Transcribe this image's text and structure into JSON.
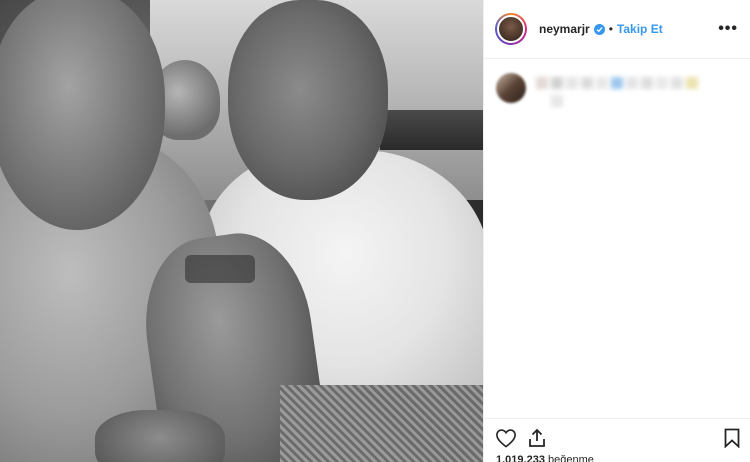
{
  "post": {
    "username": "neymarjr",
    "separator": "•",
    "follow_label": "Takip Et",
    "more_label": "•••",
    "likes_count": "1.019.233",
    "likes_suffix": "beğenme"
  },
  "colors": {
    "accent": "#3897f0",
    "text": "#262626",
    "divider": "#efefef"
  },
  "icons": {
    "verified": "verified-badge-icon",
    "like": "heart-icon",
    "share": "share-icon",
    "save": "bookmark-icon",
    "more": "more-options-icon"
  }
}
